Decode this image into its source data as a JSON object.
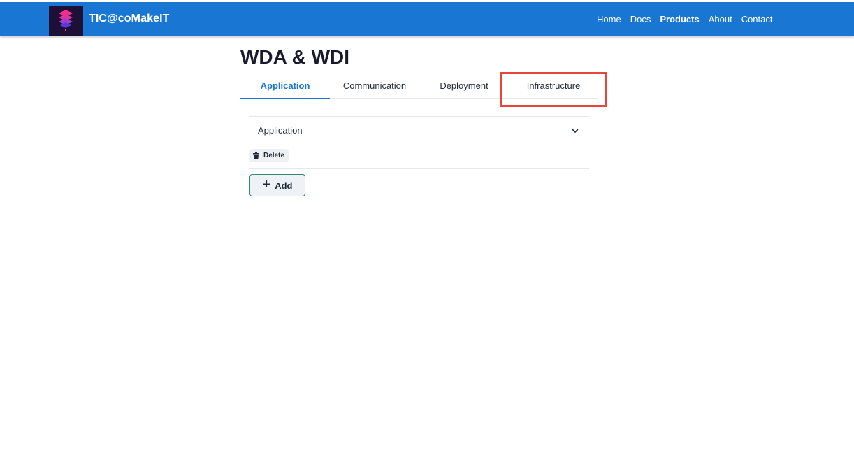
{
  "header": {
    "brand": "TIC@coMakeIT",
    "nav": [
      {
        "label": "Home",
        "active": false
      },
      {
        "label": "Docs",
        "active": false
      },
      {
        "label": "Products",
        "active": true
      },
      {
        "label": "About",
        "active": false
      },
      {
        "label": "Contact",
        "active": false
      }
    ],
    "color": "#1976d2"
  },
  "page": {
    "title": "WDA & WDI"
  },
  "tabs": [
    {
      "label": "Application",
      "active": true
    },
    {
      "label": "Communication",
      "active": false
    },
    {
      "label": "Deployment",
      "active": false
    },
    {
      "label": "Infrastructure",
      "active": false,
      "highlighted": true
    }
  ],
  "accordion": {
    "title": "Application",
    "expanded": true,
    "delete_label": "Delete"
  },
  "add_button": {
    "label": "Add"
  },
  "colors": {
    "accent": "#1976d2",
    "highlight": "#e8443a",
    "add_border": "#2e8b6f"
  }
}
